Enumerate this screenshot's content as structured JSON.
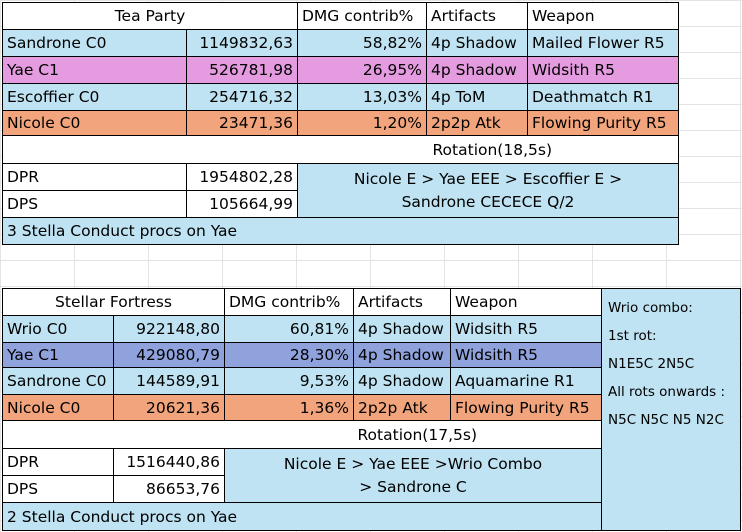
{
  "team1": {
    "header": [
      "Tea Party",
      "DMG contrib%",
      "Artifacts",
      "Weapon"
    ],
    "rows": [
      {
        "name": "Sandrone C0",
        "dmg": "1149832,63",
        "pct": "58,82%",
        "artifacts": "4p Shadow",
        "weapon": "Mailed Flower R5",
        "color": "#bfe3f2"
      },
      {
        "name": "Yae C1",
        "dmg": "526781,98",
        "pct": "26,95%",
        "artifacts": "4p Shadow",
        "weapon": "Widsith R5",
        "color": "#e59be0"
      },
      {
        "name": "Escoffier C0",
        "dmg": "254716,32",
        "pct": "13,03%",
        "artifacts": "4p ToM",
        "weapon": "Deathmatch R1",
        "color": "#bfe3f2"
      },
      {
        "name": "Nicole C0",
        "dmg": "23471,36",
        "pct": "1,20%",
        "artifacts": "2p2p Atk",
        "weapon": "Flowing Purity R5",
        "color": "#f2a57d"
      }
    ],
    "rotation": "Rotation(18,5s)",
    "dpr_label": "DPR",
    "dpr": "1954802,28",
    "dps_label": "DPS",
    "dps": "105664,99",
    "combo": [
      "Nicole E > Yae EEE > Escoffier E >",
      "Sandrone CECECE Q/2"
    ],
    "note": "3 Stella Conduct procs on Yae"
  },
  "team2": {
    "header": [
      "Stellar Fortress",
      "DMG contrib%",
      "Artifacts",
      "Weapon"
    ],
    "rows": [
      {
        "name": "Wrio C0",
        "dmg": "922148,80",
        "pct": "60,81%",
        "artifacts": "4p Shadow",
        "weapon": "Widsith R5",
        "color": "#bfe3f2"
      },
      {
        "name": "Yae C1",
        "dmg": "429080,79",
        "pct": "28,30%",
        "artifacts": "4p Shadow",
        "weapon": "Widsith R5",
        "color": "#8fa2dc"
      },
      {
        "name": "Sandrone C0",
        "dmg": "144589,91",
        "pct": "9,53%",
        "artifacts": "4p Shadow",
        "weapon": "Aquamarine R1",
        "color": "#bfe3f2"
      },
      {
        "name": "Nicole C0",
        "dmg": "20621,36",
        "pct": "1,36%",
        "artifacts": "2p2p Atk",
        "weapon": "Flowing Purity R5",
        "color": "#f2a57d"
      }
    ],
    "rotation": "Rotation(17,5s)",
    "dpr_label": "DPR",
    "dpr": "1516440,86",
    "dps_label": "DPS",
    "dps": "86653,76",
    "combo": [
      "Nicole E > Yae EEE >Wrio Combo",
      "> Sandrone C"
    ],
    "note": "2 Stella Conduct procs on Yae",
    "side_notes": [
      "Wrio combo:",
      "1st rot:",
      "N1E5C 2N5C",
      "All rots onwards :",
      "N5C N5C N5 N2C"
    ]
  }
}
